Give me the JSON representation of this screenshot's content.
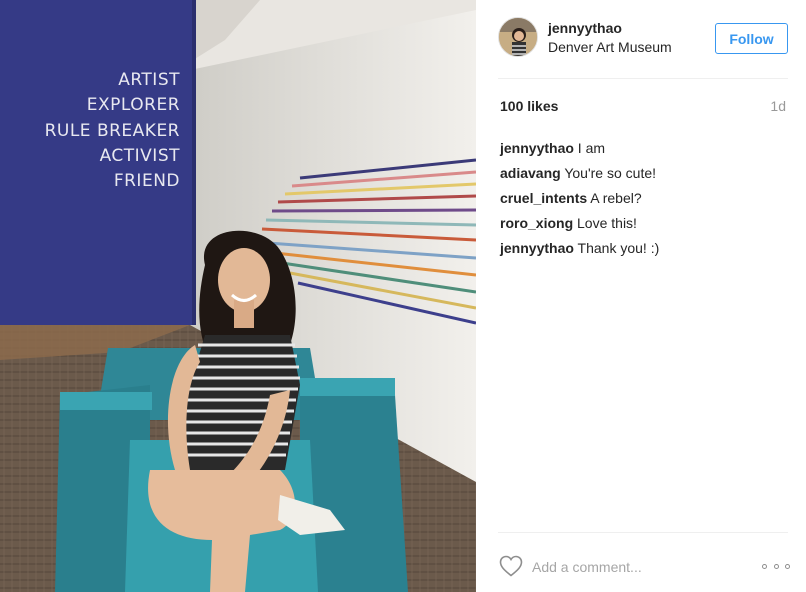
{
  "post": {
    "username": "jennyythao",
    "location": "Denver Art Museum",
    "follow_label": "Follow",
    "likes": "100 likes",
    "time_ago": "1d"
  },
  "photo": {
    "wall_text": [
      "ARTIST",
      "EXPLORER",
      "RULE BREAKER",
      "ACTIVIST",
      "FRIEND"
    ]
  },
  "comments": [
    {
      "user": "jennyythao",
      "text": "I am"
    },
    {
      "user": "adiavang",
      "text": "You're so cute!"
    },
    {
      "user": "cruel_intents",
      "text": "A rebel?"
    },
    {
      "user": "roro_xiong",
      "text": "Love this!"
    },
    {
      "user": "jennyythao",
      "text": "Thank you! :)"
    }
  ],
  "footer": {
    "comment_placeholder": "Add a comment...",
    "like_icon": "heart-icon",
    "more_icon": "more-options-icon"
  },
  "colors": {
    "accent": "#3897f0",
    "wall_blue": "#353a86",
    "chair_teal": "#2e8a98"
  }
}
